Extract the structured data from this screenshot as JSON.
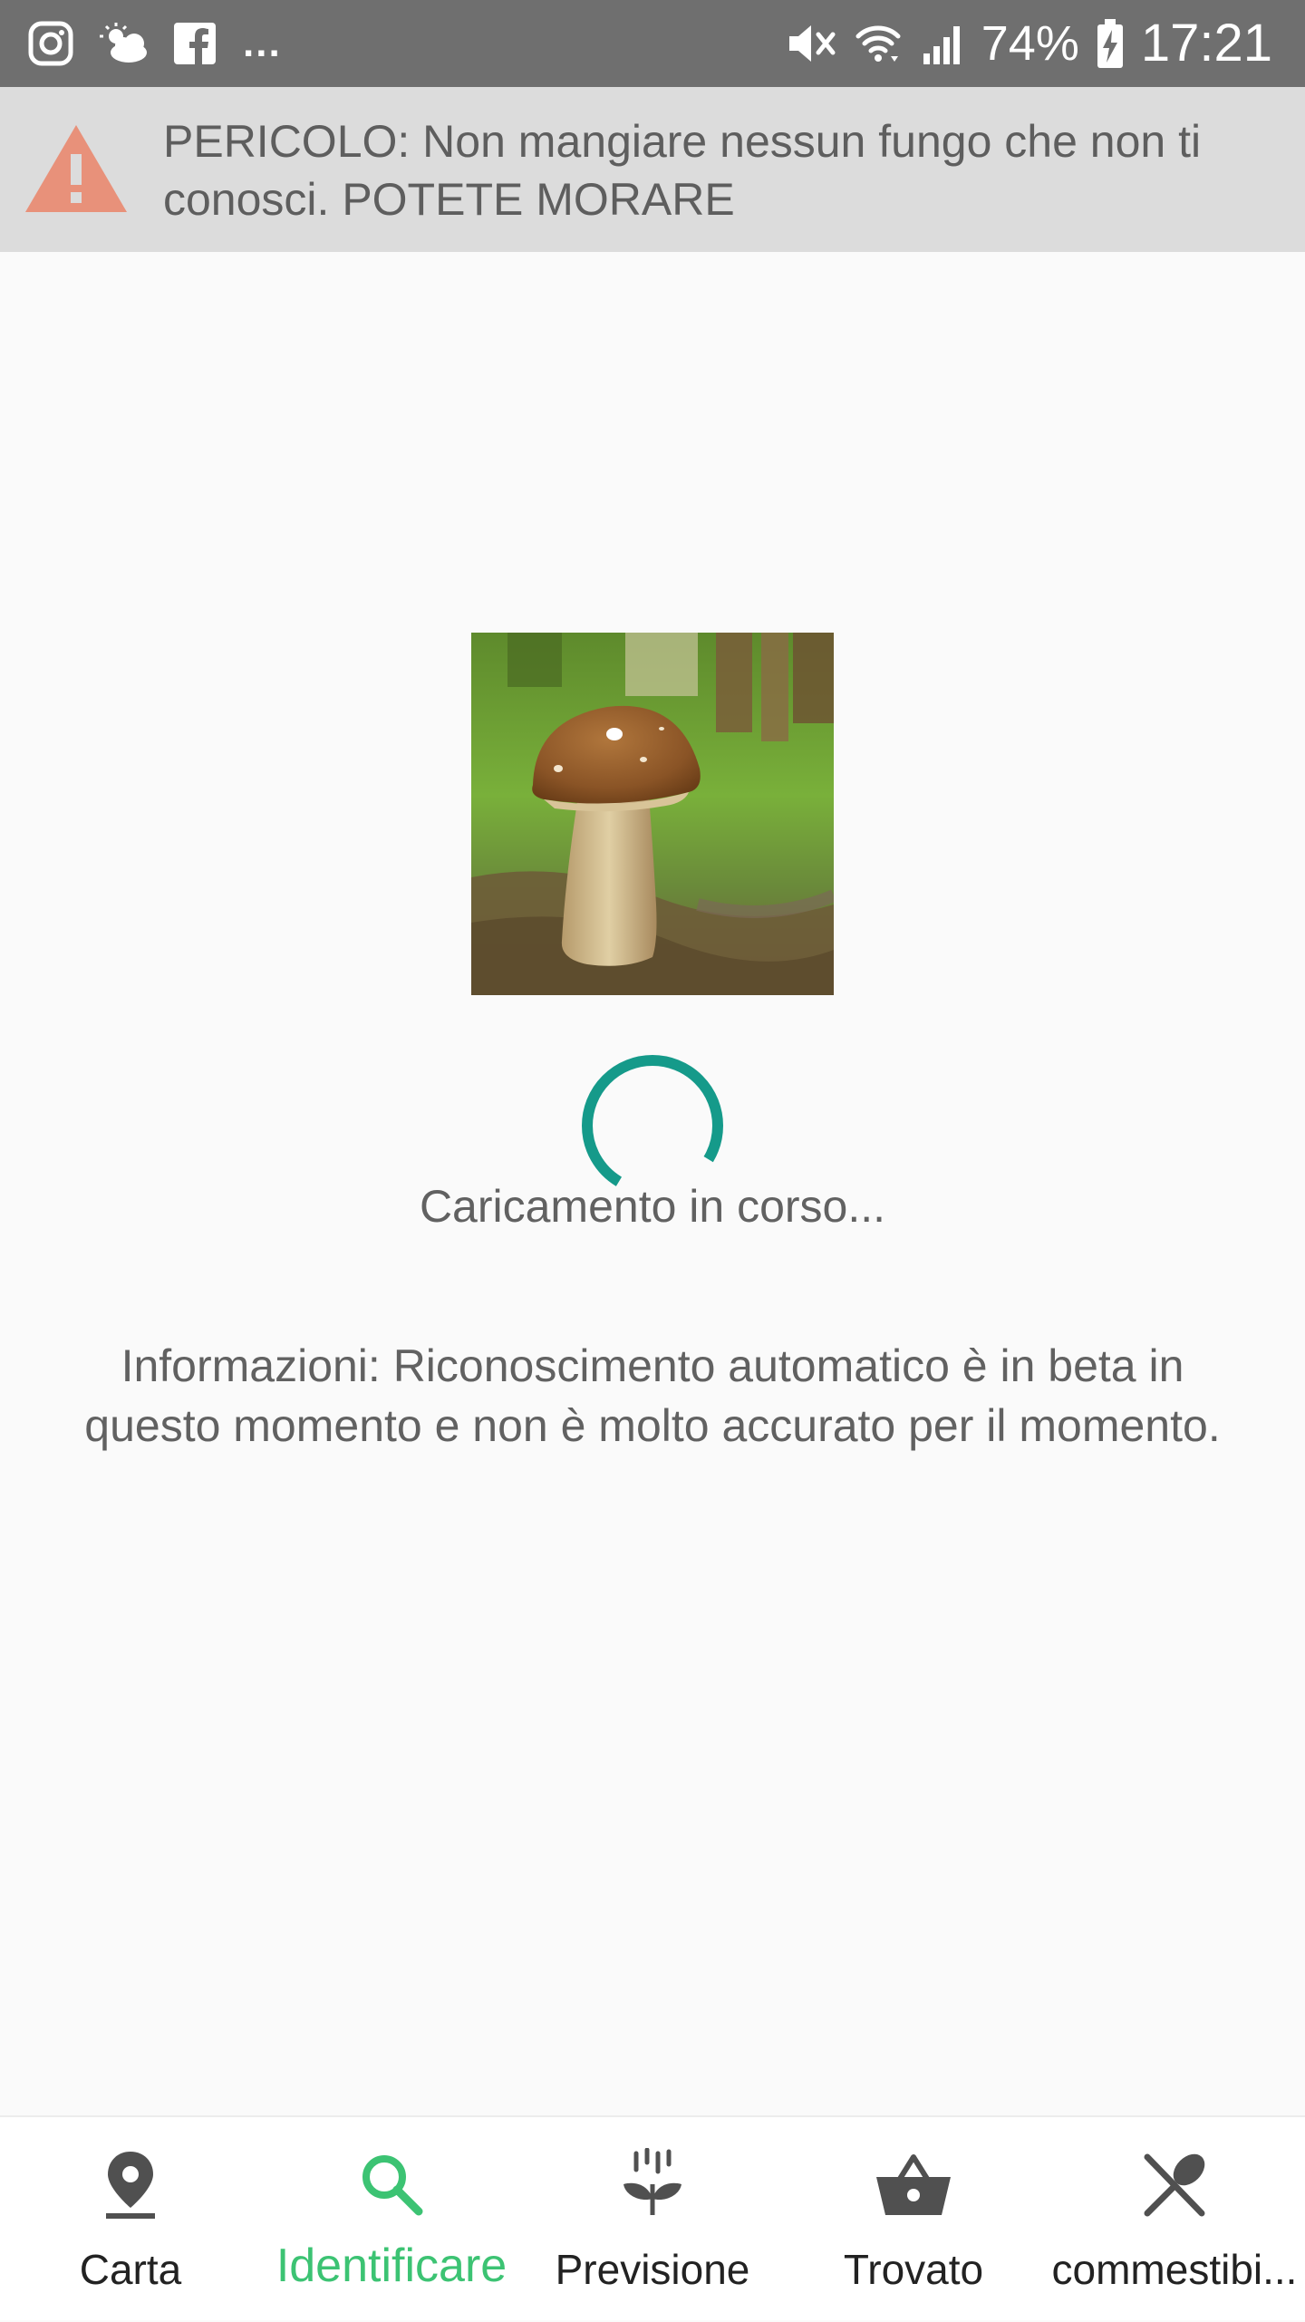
{
  "status_bar": {
    "battery_percent": "74%",
    "time": "17:21",
    "overflow_indicator": "...",
    "icons": [
      "instagram-icon",
      "weather-icon",
      "facebook-icon",
      "vibrate-mute-icon",
      "wifi-icon",
      "signal-icon",
      "battery-charging-icon"
    ]
  },
  "warning": {
    "text": "PERICOLO: Non mangiare nessun fungo che non ti conosci. POTETE MORARE",
    "icon": "warning-triangle-icon",
    "icon_color": "#e8917a"
  },
  "main": {
    "loading_text": "Caricamento in corso...",
    "info_text": "Informazioni: Riconoscimento automatico è in beta in questo momento e non è molto accurato per il momento.",
    "spinner_color": "#159a8a"
  },
  "bottom_nav": {
    "active_color": "#3cc373",
    "items": [
      {
        "label": "Carta",
        "icon": "map-pin-icon"
      },
      {
        "label": "Identificare",
        "icon": "search-icon",
        "active": true
      },
      {
        "label": "Previsione",
        "icon": "forecast-sprout-icon"
      },
      {
        "label": "Trovato",
        "icon": "basket-icon"
      },
      {
        "label": "commestibi...",
        "icon": "fork-knife-icon"
      }
    ]
  }
}
